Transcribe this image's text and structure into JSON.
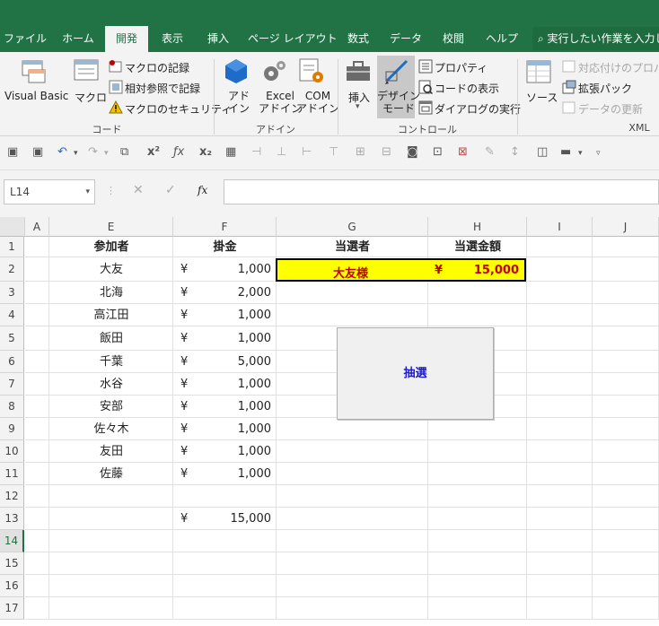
{
  "ribbon_tabs": [
    {
      "label": "ファイル",
      "active": false
    },
    {
      "label": "ホーム",
      "active": false
    },
    {
      "label": "開発",
      "active": true
    },
    {
      "label": "表示",
      "active": false
    },
    {
      "label": "挿入",
      "active": false
    },
    {
      "label": "ページ レイアウト",
      "active": false
    },
    {
      "label": "数式",
      "active": false
    },
    {
      "label": "データ",
      "active": false
    },
    {
      "label": "校閲",
      "active": false
    },
    {
      "label": "ヘルプ",
      "active": false
    }
  ],
  "search_text": "実行したい作業を入力し",
  "code_group": {
    "visual_basic": "Visual Basic",
    "macro": "マクロ",
    "record_macro": "マクロの記録",
    "relative_ref": "相対参照で記録",
    "macro_security": "マクロのセキュリティ",
    "label": "コード"
  },
  "addin_group": {
    "addin": "アド\nイン",
    "excel_addin": "Excel\nアドイン",
    "com_addin": "COM\nアドイン",
    "label": "アドイン"
  },
  "control_group": {
    "insert": "挿入",
    "design_mode": "デザイン\nモード",
    "properties": "プロパティ",
    "view_code": "コードの表示",
    "run_dialog": "ダイアログの実行",
    "label": "コントロール"
  },
  "xml_group": {
    "source": "ソース",
    "map_properties": "対応付けのプロパティ",
    "expansion_packs": "拡張パック",
    "refresh_data": "データの更新",
    "label": "XML"
  },
  "name_box": "L14",
  "formula_fx": "fx",
  "columns": [
    "A",
    "E",
    "F",
    "G",
    "H",
    "I",
    "J"
  ],
  "rows": [
    "1",
    "2",
    "3",
    "4",
    "5",
    "6",
    "7",
    "8",
    "9",
    "10",
    "11",
    "12",
    "13",
    "14",
    "15",
    "16",
    "17"
  ],
  "selected_row": "14",
  "headers": {
    "participant": "参加者",
    "stake": "掛金",
    "winner": "当選者",
    "prize": "当選金額"
  },
  "entries": [
    {
      "name": "大友",
      "yen": "¥",
      "amount": "1,000"
    },
    {
      "name": "北海",
      "yen": "¥",
      "amount": "2,000"
    },
    {
      "name": "高江田",
      "yen": "¥",
      "amount": "1,000"
    },
    {
      "name": "飯田",
      "yen": "¥",
      "amount": "1,000"
    },
    {
      "name": "千葉",
      "yen": "¥",
      "amount": "5,000"
    },
    {
      "name": "水谷",
      "yen": "¥",
      "amount": "1,000"
    },
    {
      "name": "安部",
      "yen": "¥",
      "amount": "1,000"
    },
    {
      "name": "佐々木",
      "yen": "¥",
      "amount": "1,000"
    },
    {
      "name": "友田",
      "yen": "¥",
      "amount": "1,000"
    },
    {
      "name": "佐藤",
      "yen": "¥",
      "amount": "1,000"
    }
  ],
  "total": {
    "yen": "¥",
    "amount": "15,000"
  },
  "result": {
    "winner": "大友様",
    "yen": "¥",
    "amount": "15,000",
    "text_color": "#c00000",
    "fill": "#ffff00"
  },
  "draw_button": "抽選",
  "colors": {
    "excel_green": "#217346",
    "button_text": "#1b1bd0"
  }
}
